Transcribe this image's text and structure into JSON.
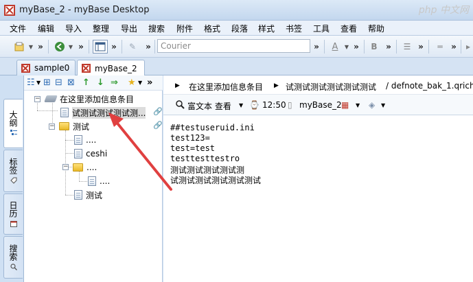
{
  "window": {
    "title": "myBase_2 - myBase Desktop",
    "watermark": "php 中文网"
  },
  "menu": [
    "文件",
    "编辑",
    "导入",
    "整理",
    "导出",
    "搜索",
    "附件",
    "格式",
    "段落",
    "样式",
    "书签",
    "工具",
    "查看",
    "帮助"
  ],
  "toolbar": {
    "font": "Courier",
    "overflow": "»"
  },
  "tabs": [
    {
      "label": "sample0",
      "active": false
    },
    {
      "label": "myBase_2",
      "active": true
    }
  ],
  "side_tabs": [
    {
      "label": "大纲",
      "active": true
    },
    {
      "label": "标签",
      "active": false
    },
    {
      "label": "日历",
      "active": false
    },
    {
      "label": "搜索",
      "active": false
    }
  ],
  "tree": {
    "root": "在这里添加信息条目",
    "items": [
      {
        "label": "试测试测试测试测...",
        "selected": true
      },
      {
        "label": "测试"
      },
      {
        "label": "...."
      },
      {
        "label": "ceshi"
      },
      {
        "label": "...."
      },
      {
        "label": "...."
      },
      {
        "label": "测试"
      }
    ]
  },
  "breadcrumb": [
    "在这里添加信息条目",
    "试测试测试测试测试测试",
    "/ defnote_bak_1.qrich"
  ],
  "infobar": {
    "view_mode": "富文本 查看",
    "time": "12:50",
    "db": "myBase_2"
  },
  "content": {
    "lines": [
      "##testuseruid.ini",
      "test123=",
      "test=test",
      "testtesttestro",
      "测试测试测试测试测",
      "试测试测试测试测试测试"
    ]
  }
}
